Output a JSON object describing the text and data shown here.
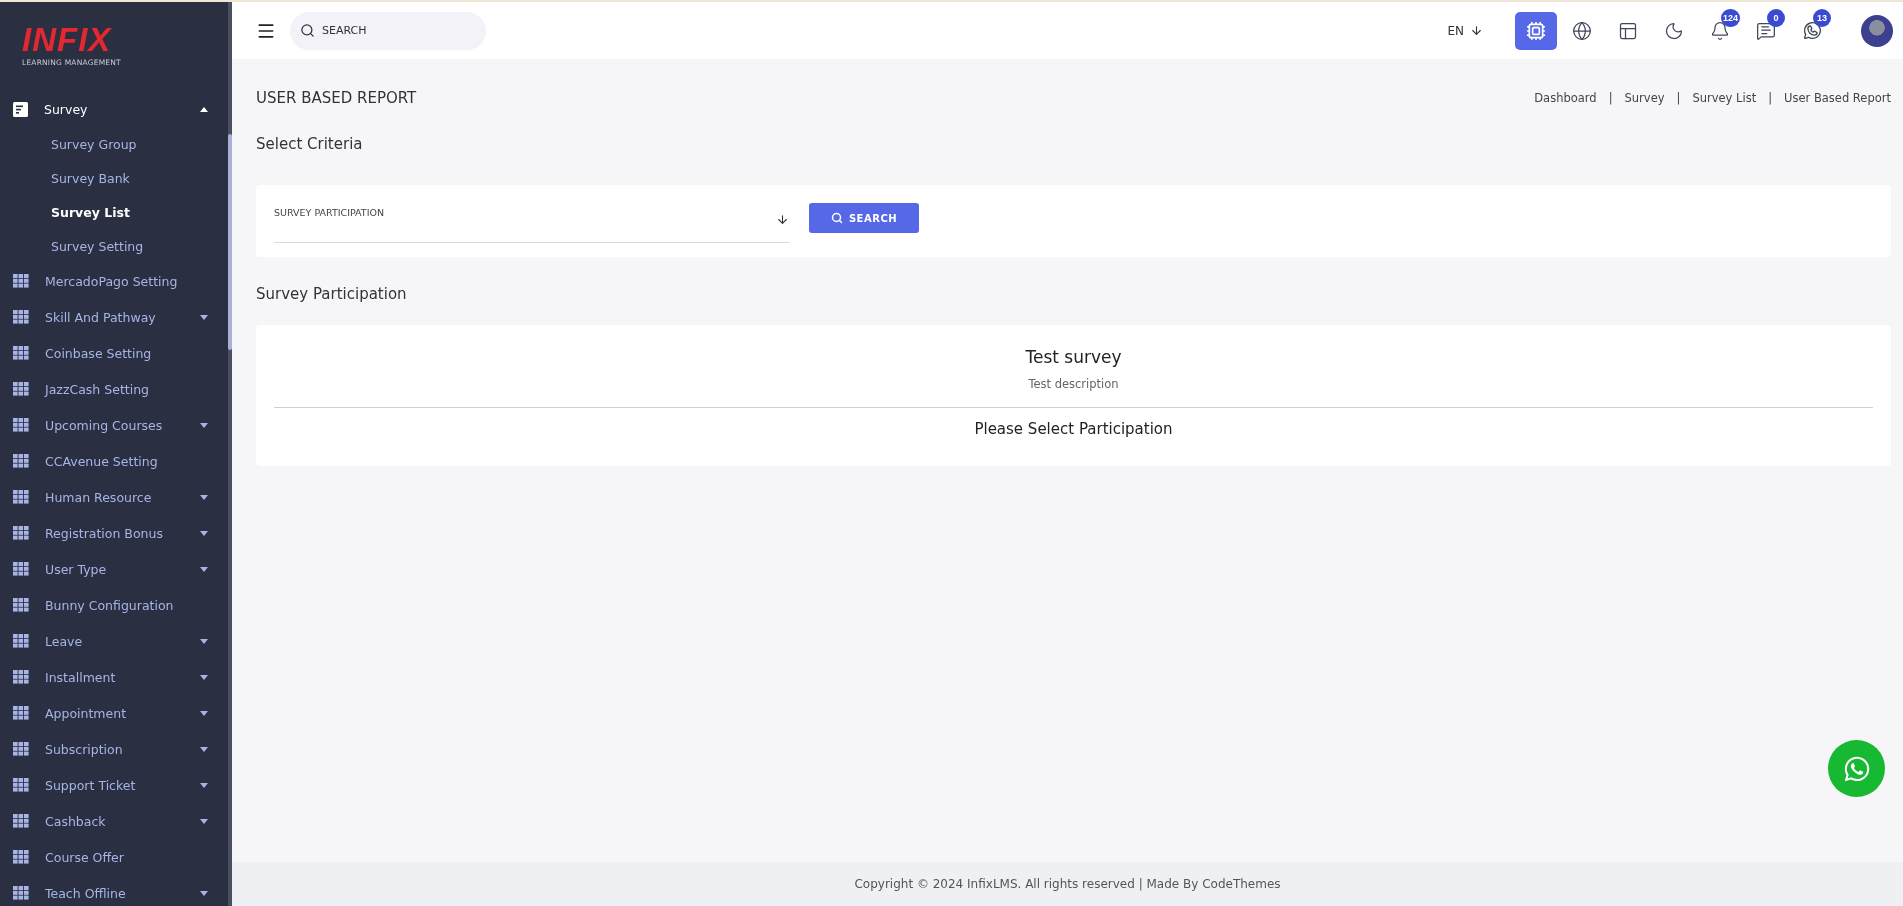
{
  "logo": {
    "wordmark": "INFIX",
    "tagline": "LEARNING MANAGEMENT"
  },
  "sidebar": {
    "items": [
      {
        "label": "Survey",
        "kind": "menu",
        "active": true,
        "expanded": true,
        "children": [
          {
            "label": "Survey Group",
            "selected": false
          },
          {
            "label": "Survey Bank",
            "selected": false
          },
          {
            "label": "Survey List",
            "selected": true
          },
          {
            "label": "Survey Setting",
            "selected": false
          }
        ]
      },
      {
        "label": "MercadoPago Setting",
        "kind": "link",
        "active": false
      },
      {
        "label": "Skill And Pathway",
        "kind": "menu",
        "active": false,
        "expanded": false
      },
      {
        "label": "Coinbase Setting",
        "kind": "link",
        "active": false
      },
      {
        "label": "JazzCash Setting",
        "kind": "link",
        "active": false
      },
      {
        "label": "Upcoming Courses",
        "kind": "menu",
        "active": false,
        "expanded": false
      },
      {
        "label": "CCAvenue Setting",
        "kind": "link",
        "active": false
      },
      {
        "label": "Human Resource",
        "kind": "menu",
        "active": false,
        "expanded": false
      },
      {
        "label": "Registration Bonus",
        "kind": "menu",
        "active": false,
        "expanded": false
      },
      {
        "label": "User Type",
        "kind": "menu",
        "active": false,
        "expanded": false
      },
      {
        "label": "Bunny Configuration",
        "kind": "link",
        "active": false
      },
      {
        "label": "Leave",
        "kind": "menu",
        "active": false,
        "expanded": false
      },
      {
        "label": "Installment",
        "kind": "menu",
        "active": false,
        "expanded": false
      },
      {
        "label": "Appointment",
        "kind": "menu",
        "active": false,
        "expanded": false
      },
      {
        "label": "Subscription",
        "kind": "menu",
        "active": false,
        "expanded": false
      },
      {
        "label": "Support Ticket",
        "kind": "menu",
        "active": false,
        "expanded": false
      },
      {
        "label": "Cashback",
        "kind": "menu",
        "active": false,
        "expanded": false
      },
      {
        "label": "Course Offer",
        "kind": "link",
        "active": false
      },
      {
        "label": "Teach Offline",
        "kind": "menu",
        "active": false,
        "expanded": false
      }
    ]
  },
  "header": {
    "search": {
      "placeholder": "SEARCH"
    },
    "language": "EN",
    "icons": [
      {
        "kind": "ai",
        "selected": true
      },
      {
        "kind": "globe",
        "selected": false
      },
      {
        "kind": "layout",
        "selected": false
      },
      {
        "kind": "moon",
        "selected": false
      },
      {
        "kind": "bell",
        "selected": false,
        "badge": "124"
      },
      {
        "kind": "chat",
        "selected": false,
        "badge": "0"
      },
      {
        "kind": "whatsapp",
        "selected": false,
        "badge": "13"
      }
    ]
  },
  "page": {
    "title": "USER BASED REPORT",
    "breadcrumb": {
      "separator": "|",
      "items": [
        "Dashboard",
        "Survey",
        "Survey List",
        "User Based Report"
      ]
    },
    "criteria": {
      "heading": "Select Criteria",
      "select_label": "SURVEY PARTICIPATION",
      "button": "SEARCH"
    },
    "participation": {
      "heading": "Survey Participation",
      "survey_title": "Test survey",
      "survey_description": "Test description",
      "message": "Please Select Participation"
    }
  },
  "footer": "Copyright © 2024 InfixLMS. All rights reserved | Made By CodeThemes"
}
